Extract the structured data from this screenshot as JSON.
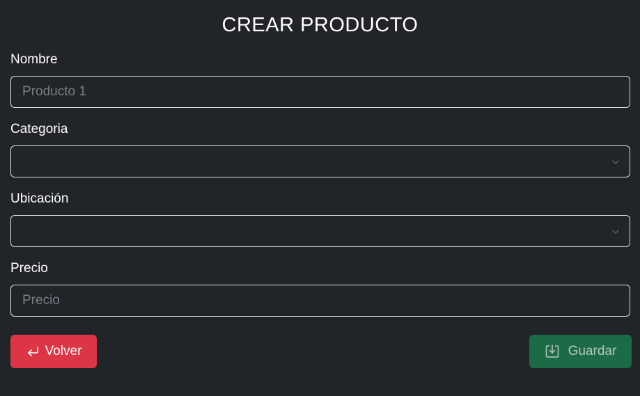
{
  "page": {
    "title": "CREAR PRODUCTO"
  },
  "form": {
    "nombre": {
      "label": "Nombre",
      "placeholder": "Producto 1",
      "value": ""
    },
    "categoria": {
      "label": "Categoria",
      "selected": ""
    },
    "ubicacion": {
      "label": "Ubicación",
      "selected": ""
    },
    "precio": {
      "label": "Precio",
      "placeholder": "Precio",
      "value": ""
    }
  },
  "actions": {
    "back": {
      "label": "Volver",
      "icon": "enter-return-icon",
      "color": "#dc3545"
    },
    "save": {
      "label": "Guardar",
      "icon": "download-box-icon",
      "color": "#1c6b47"
    }
  },
  "theme": {
    "background": "#212529",
    "border": "#dee2e6"
  }
}
